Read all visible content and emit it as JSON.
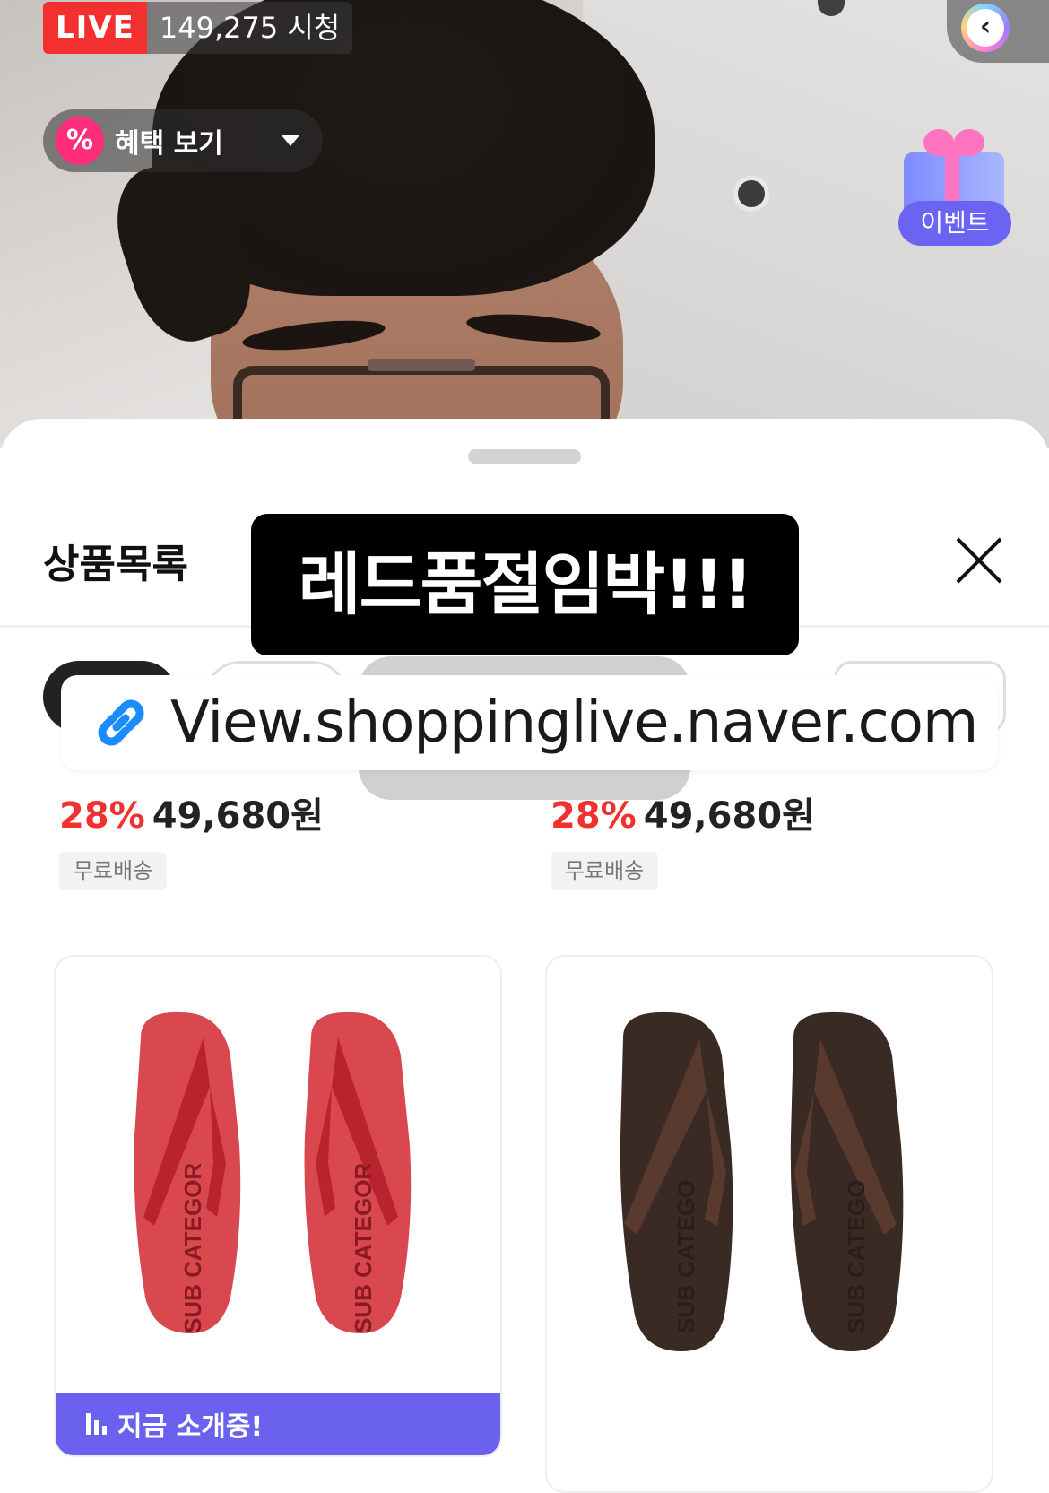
{
  "live": {
    "tag": "LIVE",
    "viewers": "149,275 시청"
  },
  "benefit": {
    "icon_text": "%",
    "label": "혜택 보기"
  },
  "event": {
    "label": "이벤트"
  },
  "back_icon_text": "‹",
  "sheet": {
    "title": "상품목록",
    "announcement": "레드품절임박!!!",
    "link_text": "View.shoppinglive.naver.com"
  },
  "products_top": [
    {
      "discount": "28%",
      "price": "49,680원",
      "shipping": "무료배송"
    },
    {
      "discount": "28%",
      "price": "49,680원",
      "shipping": "무료배송"
    }
  ],
  "products": [
    {
      "color": "#d9474f",
      "strap": "#b8242e",
      "print": "SUB CATEGOR",
      "now_label": "지금 소개중!"
    },
    {
      "color": "#3a2a24",
      "strap": "#5a3a2e",
      "print": "SUB CATEGO"
    }
  ],
  "colors": {
    "live_red": "#f2302f",
    "accent_purple": "#6a62ee",
    "discount_red": "#f2302f"
  }
}
